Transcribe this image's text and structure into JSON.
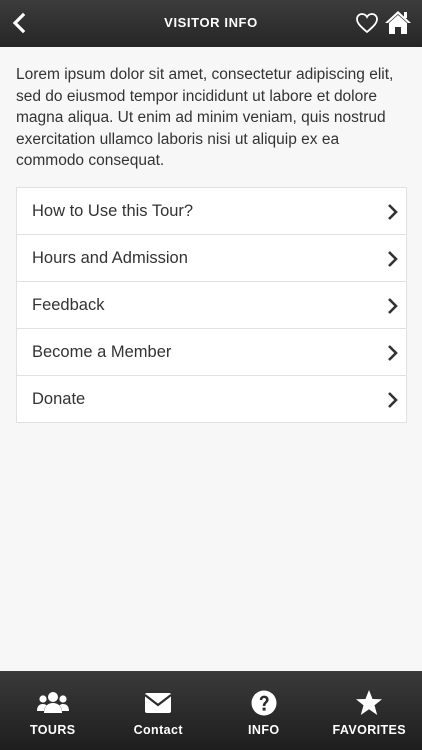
{
  "header": {
    "title": "VISITOR INFO",
    "back_icon": "chevron-left-icon",
    "favorite_icon": "heart-icon",
    "home_icon": "home-icon"
  },
  "intro_text": "Lorem ipsum dolor sit amet, consectetur adipiscing elit, sed do eiusmod tempor incididunt ut labore et dolore magna aliqua. Ut enim ad minim veniam, quis nostrud exercitation ullamco laboris nisi ut aliquip ex ea commodo consequat.",
  "menu": {
    "items": [
      {
        "label": "How to Use this Tour?"
      },
      {
        "label": "Hours and Admission"
      },
      {
        "label": "Feedback"
      },
      {
        "label": "Become a Member"
      },
      {
        "label": "Donate"
      }
    ]
  },
  "tabbar": {
    "tabs": [
      {
        "label": "TOURS",
        "icon": "users-icon"
      },
      {
        "label": "Contact",
        "icon": "envelope-icon"
      },
      {
        "label": "INFO",
        "icon": "question-circle-icon"
      },
      {
        "label": "FAVORITES",
        "icon": "star-icon"
      }
    ]
  },
  "colors": {
    "header_bg": "#2f2f2f",
    "page_bg": "#f7f7f7",
    "text": "#333333",
    "border": "#e1e1e1"
  }
}
